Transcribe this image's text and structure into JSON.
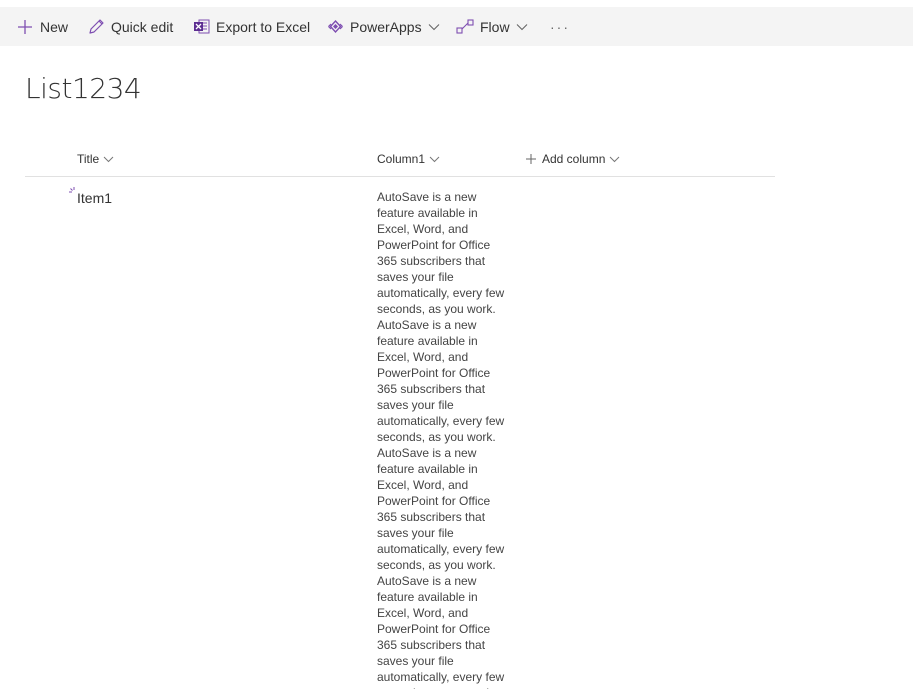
{
  "commandbar": {
    "new_label": "New",
    "quickedit_label": "Quick edit",
    "export_label": "Export to Excel",
    "powerapps_label": "PowerApps",
    "flow_label": "Flow",
    "more_label": "···"
  },
  "list": {
    "title": "List1234",
    "columns": {
      "title": "Title",
      "col1": "Column1",
      "add": "Add column"
    },
    "rows": [
      {
        "title": "Item1",
        "col1_lines": [
          "AutoSave is a new",
          "feature available in",
          "Excel, Word, and",
          "PowerPoint for Office",
          "365 subscribers that",
          "saves your file",
          "automatically, every few",
          "seconds, as you work.",
          "AutoSave is a new",
          "feature available in",
          "Excel, Word, and",
          "PowerPoint for Office",
          "365 subscribers that",
          "saves your file",
          "automatically, every few",
          "seconds, as you work.",
          "AutoSave is a new",
          "feature available in",
          "Excel, Word, and",
          "PowerPoint for Office",
          "365 subscribers that",
          "saves your file",
          "automatically, every few",
          "seconds, as you work.",
          "AutoSave is a new",
          "feature available in",
          "Excel, Word, and",
          "PowerPoint for Office",
          "365 subscribers that",
          "saves your file",
          "automatically, every few",
          "seconds, as you work."
        ]
      }
    ]
  },
  "colors": {
    "accent": "#7E4EB1",
    "excel_icon": "#5C2D91",
    "commandbar_bg": "#F4F4F4"
  },
  "icons": {
    "new": "plus-icon",
    "quickedit": "pencil-icon",
    "export": "excel-icon",
    "powerapps": "powerapps-icon",
    "flow": "flow-icon"
  }
}
